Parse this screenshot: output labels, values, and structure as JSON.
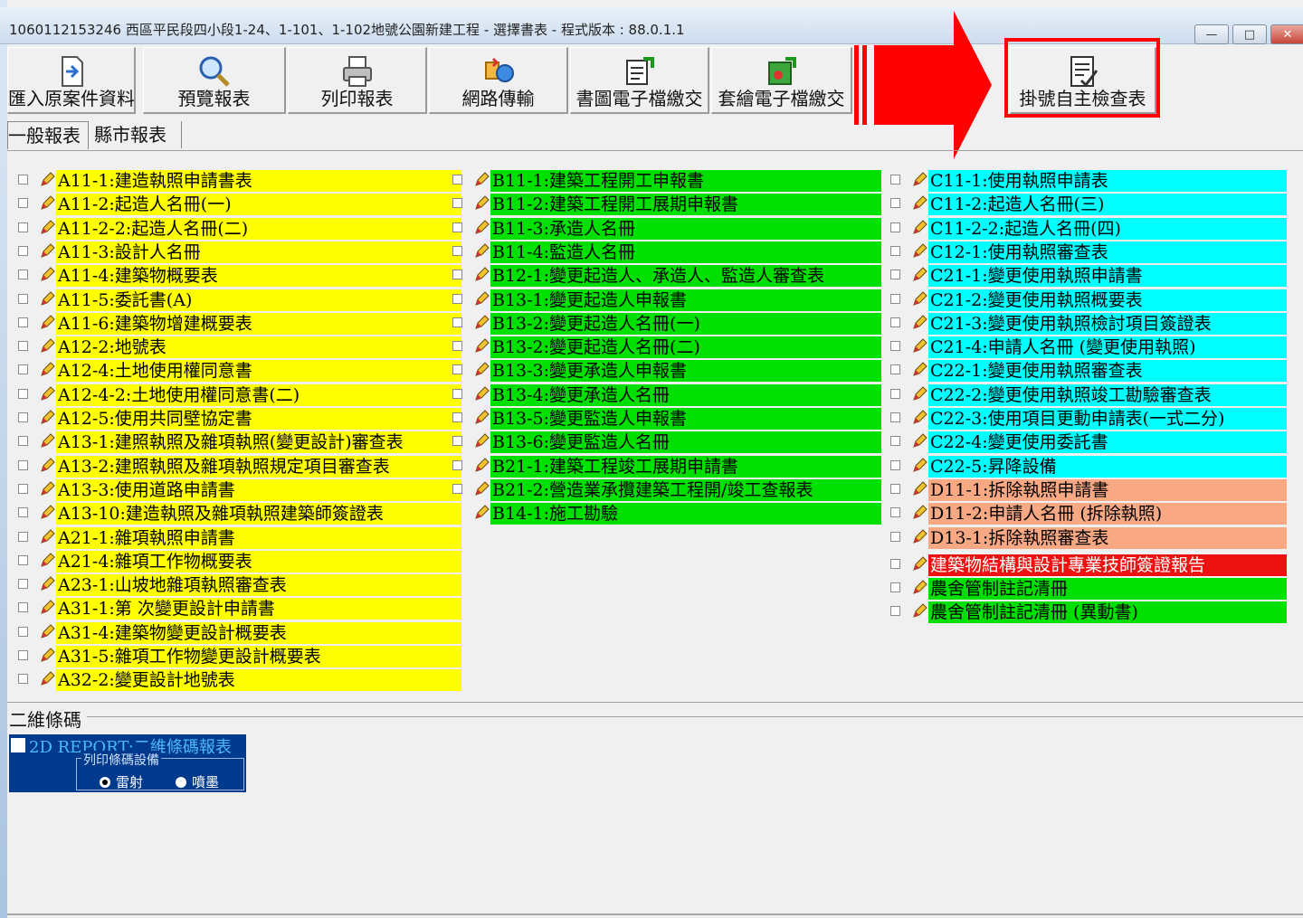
{
  "window": {
    "title": "1060112153246 西區平民段四小段1-24、1-101、1-102地號公園新建工程 - 選擇書表 - 程式版本 : 88.0.1.1"
  },
  "toolbar": {
    "buttons": [
      {
        "label": "匯入原案件資料",
        "icon": "import-icon"
      },
      {
        "label": "預覽報表",
        "icon": "magnifier-icon"
      },
      {
        "label": "列印報表",
        "icon": "printer-icon"
      },
      {
        "label": "網路傳輸",
        "icon": "network-icon"
      },
      {
        "label": "書圖電子檔繳交",
        "icon": "doc-export-icon"
      },
      {
        "label": "套繪電子檔繳交",
        "icon": "drawing-export-icon"
      },
      {
        "label": "掛號自主檢查表",
        "icon": "checklist-icon"
      }
    ]
  },
  "tabs": [
    "一般報表",
    "縣市報表"
  ],
  "colors": {
    "yellow": "#ffff00",
    "green": "#00e000",
    "cyan": "#00ffff",
    "orange": "#f8a882",
    "red": "#ee1111",
    "arrow": "#ff0000"
  },
  "reports": {
    "col1": [
      "A11-1:建造執照申請書表",
      "A11-2:起造人名冊(一)",
      "A11-2-2:起造人名冊(二)",
      "A11-3:設計人名冊",
      "A11-4:建築物概要表",
      "A11-5:委託書(A)",
      "A11-6:建築物增建概要表",
      "A12-2:地號表",
      "A12-4:土地使用權同意書",
      "A12-4-2:土地使用權同意書(二)",
      "A12-5:使用共同壁協定書",
      "A13-1:建照執照及雜項執照(變更設計)審查表",
      "A13-2:建照執照及雜項執照規定項目審查表",
      "A13-3:使用道路申請書",
      "A13-10:建造執照及雜項執照建築師簽證表",
      "A21-1:雜項執照申請書",
      "A21-4:雜項工作物概要表",
      "A23-1:山坡地雜項執照審查表",
      "A31-1:第 次變更設計申請書",
      "A31-4:建築物變更設計概要表",
      "A31-5:雜項工作物變更設計概要表",
      "A32-2:變更設計地號表"
    ],
    "col2": [
      "B11-1:建築工程開工申報書",
      "B11-2:建築工程開工展期申報書",
      "B11-3:承造人名冊",
      "B11-4:監造人名冊",
      "B12-1:變更起造人、承造人、監造人審查表",
      "B13-1:變更起造人申報書",
      "B13-2:變更起造人名冊(一)",
      "B13-2:變更起造人名冊(二)",
      "B13-3:變更承造人申報書",
      "B13-4:變更承造人名冊",
      "B13-5:變更監造人申報書",
      "B13-6:變更監造人名冊",
      "B21-1:建築工程竣工展期申請書",
      "B21-2:營造業承攬建築工程開/竣工查報表",
      "B14-1:施工勘驗"
    ],
    "col3": [
      "C11-1:使用執照申請表",
      "C11-2:起造人名冊(三)",
      "C11-2-2:起造人名冊(四)",
      "C12-1:使用執照審查表",
      "C21-1:變更使用執照申請書",
      "C21-2:變更使用執照概要表",
      "C21-3:變更使用執照檢討項目簽證表",
      "C21-4:申請人名冊 (變更使用執照)",
      "C22-1:變更使用執照審查表",
      "C22-2:變更使用執照竣工勘驗審查表",
      "C22-3:使用項目更動申請表(一式二分)",
      "C22-4:變更使用委託書",
      "C22-5:昇降設備",
      "D11-1:拆除執照申請書",
      "D11-2:申請人名冊 (拆除執照)",
      "D13-1:拆除執照審查表",
      "建築物結構與設計專業技師簽證報告",
      "農舍管制註記清冊",
      "農舍管制註記清冊 (異動書)"
    ]
  },
  "barcode": {
    "group_label": "二維條碼",
    "report_label": "2D REPORT:二維條碼報表",
    "device_label": "列印條碼設備",
    "options": [
      "雷射",
      "噴墨"
    ],
    "selected": "雷射"
  }
}
